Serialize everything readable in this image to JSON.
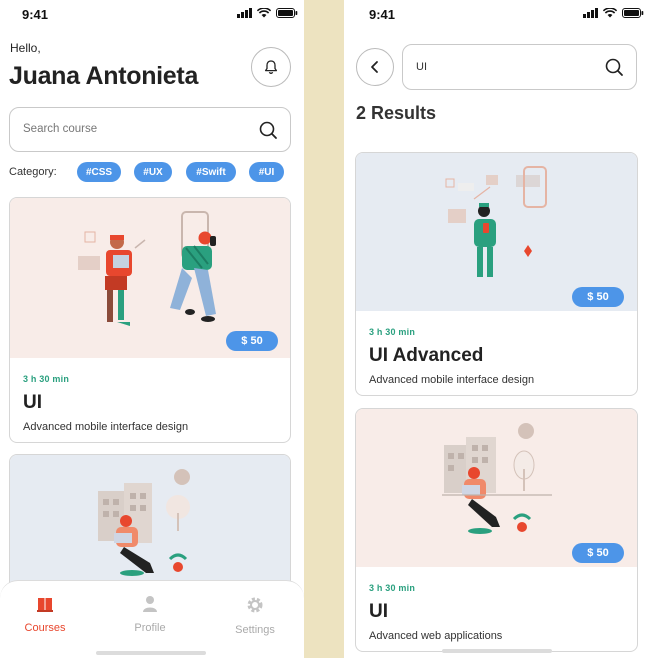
{
  "status": {
    "time": "9:41"
  },
  "home": {
    "greeting": "Hello,",
    "user_name": "Juana Antonieta",
    "search_placeholder": "Search course",
    "category_label": "Category:",
    "categories": [
      "#CSS",
      "#UX",
      "#Swift",
      "#UI"
    ],
    "cards": [
      {
        "price": "$ 50",
        "duration": "3 h 30 min",
        "title": "UI",
        "subtitle": "Advanced mobile interface design"
      }
    ],
    "nav": [
      {
        "label": "Courses",
        "icon": "book-icon",
        "active": true
      },
      {
        "label": "Profile",
        "icon": "person-icon",
        "active": false
      },
      {
        "label": "Settings",
        "icon": "gear-icon",
        "active": false
      }
    ]
  },
  "search": {
    "query": "UI",
    "results_label": "2 Results",
    "cards": [
      {
        "price": "$ 50",
        "duration": "3 h 30 min",
        "title": "UI Advanced",
        "subtitle": "Advanced mobile interface design"
      },
      {
        "price": "$ 50",
        "duration": "3 h 30 min",
        "title": "UI",
        "subtitle": "Advanced web applications"
      }
    ]
  },
  "colors": {
    "accent_blue": "#4d95e8",
    "accent_red": "#e8472e",
    "duration_green": "#2aa07f",
    "card_pink_bg": "#f8ece8",
    "card_blue_bg": "#e6ebf2",
    "page_bg": "#ede3c0"
  }
}
